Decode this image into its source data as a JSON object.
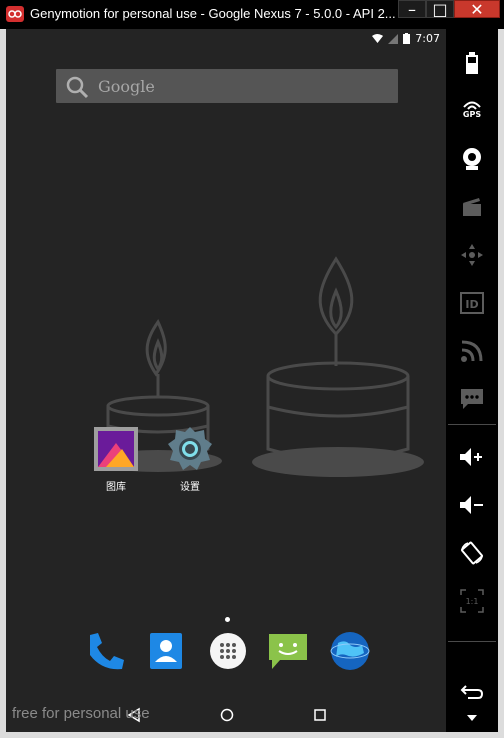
{
  "window": {
    "title": "Genymotion for personal use - Google Nexus 7 - 5.0.0 - API 2...",
    "minimize": "–",
    "maximize": "□",
    "close": "✕"
  },
  "statusbar": {
    "time": "7:07"
  },
  "search": {
    "placeholder": "Google"
  },
  "apps": [
    {
      "label": "图库",
      "icon": "gallery-icon"
    },
    {
      "label": "设置",
      "icon": "settings-icon"
    }
  ],
  "dock": [
    "phone-icon",
    "contacts-icon",
    "app-drawer-icon",
    "messaging-icon",
    "browser-icon"
  ],
  "watermark": "free for personal use",
  "sidebar": {
    "gps": "GPS",
    "id": "ID",
    "pixel_ratio": "1:1",
    "items": [
      "battery-icon",
      "gps-icon",
      "webcam-icon",
      "video-capture-icon",
      "navigation-icon",
      "id-icon",
      "rss-icon",
      "sms-icon",
      "volume-up-icon",
      "volume-down-icon",
      "rotate-icon",
      "pixel-perfect-icon",
      "back-icon",
      "menu-down-icon"
    ]
  },
  "colors": {
    "accent": "#d32f2f",
    "screen_bg": "#242424",
    "wallpaper_shapes": "#4a4a4a"
  }
}
